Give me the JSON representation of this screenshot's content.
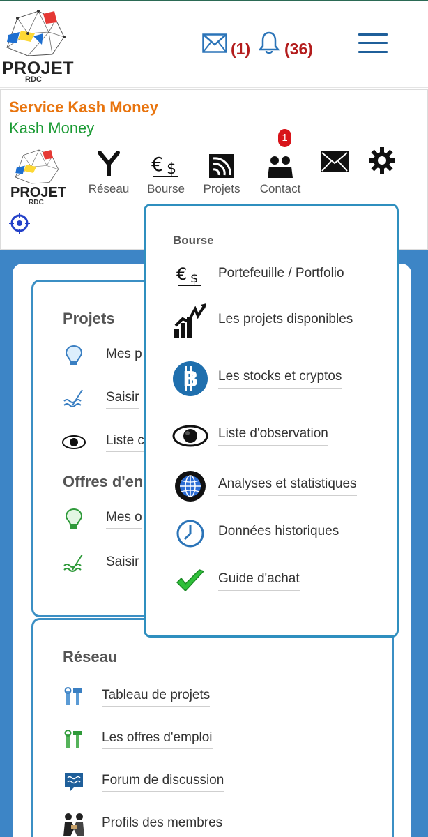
{
  "header": {
    "logo_text": "PROJET",
    "logo_sub": "RDC",
    "mail_count": "(1)",
    "notif_count": "(36)"
  },
  "service": {
    "title": "Service Kash Money",
    "subtitle": "Kash Money",
    "nav": [
      {
        "label": "Réseau",
        "icon": "network-fork-icon"
      },
      {
        "label": "Bourse",
        "icon": "currency-icon"
      },
      {
        "label": "Projets",
        "icon": "rss-icon"
      },
      {
        "label": "Contact",
        "icon": "people-icon"
      },
      {
        "label": "",
        "icon": "mail-icon"
      },
      {
        "label": "",
        "icon": "gear-icon"
      }
    ],
    "contact_badge": "1"
  },
  "sections": {
    "projets": {
      "title": "Projets",
      "items": [
        "Mes p",
        "Saisir",
        "Liste c"
      ]
    },
    "offres": {
      "title": "Offres d'en",
      "items": [
        "Mes o",
        "Saisir"
      ]
    },
    "reseau": {
      "title": "Réseau",
      "items": [
        "Tableau de projets",
        "Les offres d'emploi",
        "Forum de discussion",
        "Profils des membres"
      ]
    }
  },
  "dropdown": {
    "title": "Bourse",
    "items": [
      {
        "label": "Portefeuille / Portfolio",
        "icon": "currency-icon"
      },
      {
        "label": "Les projets disponibles",
        "icon": "stock-chart-icon"
      },
      {
        "label": "Les stocks et cryptos",
        "icon": "bitcoin-icon"
      },
      {
        "label": "Liste d'observation",
        "icon": "eye-icon"
      },
      {
        "label": "Analyses et statistiques",
        "icon": "globe-icon"
      },
      {
        "label": "Données historiques",
        "icon": "clock-icon"
      },
      {
        "label": "Guide d'achat",
        "icon": "checkmark-icon"
      }
    ]
  },
  "colors": {
    "accent_blue": "#3d85c6",
    "orange": "#e8740e",
    "green": "#1a9a33",
    "badge_red": "#d8141a",
    "count_red": "#b31c1c"
  }
}
